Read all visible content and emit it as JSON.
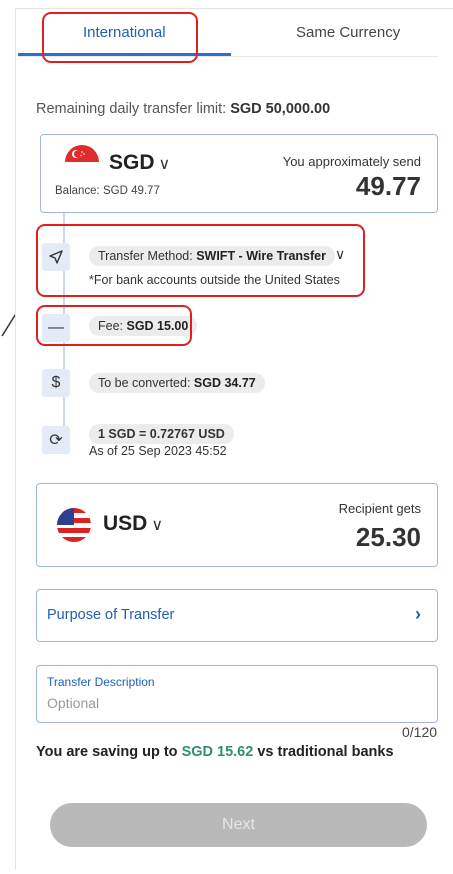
{
  "tabs": {
    "international": "International",
    "same_currency": "Same Currency"
  },
  "limit": {
    "label": "Remaining daily transfer limit:",
    "value": "SGD 50,000.00"
  },
  "send": {
    "currency": "SGD",
    "balance": "Balance: SGD 49.77",
    "label": "You approximately send",
    "amount": "49.77"
  },
  "steps": {
    "method_label": "Transfer Method:",
    "method_value": "SWIFT - Wire Transfer",
    "method_note": "*For bank accounts outside the United States",
    "fee_label": "Fee:",
    "fee_value": "SGD 15.00",
    "convert_label": "To be converted:",
    "convert_value": "SGD 34.77",
    "rate": "1 SGD = 0.72767 USD",
    "rate_date": "As of 25 Sep 2023 45:52"
  },
  "receive": {
    "currency": "USD",
    "label": "Recipient gets",
    "amount": "25.30"
  },
  "purpose": {
    "label": "Purpose of Transfer"
  },
  "description": {
    "label": "Transfer Description",
    "placeholder": "Optional",
    "counter": "0/120"
  },
  "saving": {
    "prefix": "You are saving up to",
    "amount": "SGD 15.62",
    "suffix": "vs traditional banks"
  },
  "next_label": "Next"
}
